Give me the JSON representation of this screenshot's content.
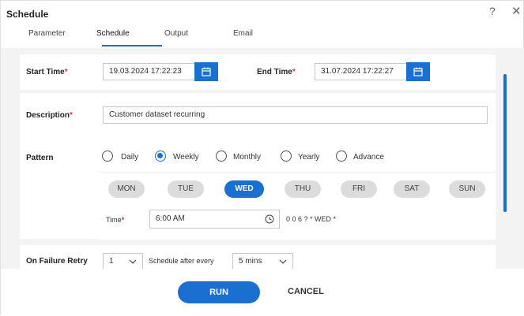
{
  "window": {
    "title": "Schedule",
    "help_glyph": "?",
    "close_glyph": "✕"
  },
  "tabs": [
    "Parameter",
    "Schedule",
    "Output",
    "Email"
  ],
  "start_time": {
    "label": "Start Time",
    "value": "19.03.2024 17:22:23"
  },
  "end_time": {
    "label": "End Time",
    "value": "31.07.2024 17:22:27"
  },
  "description": {
    "label": "Description",
    "value": "Customer dataset recurring"
  },
  "pattern": {
    "label": "Pattern",
    "options": [
      "Daily",
      "Weekly",
      "Monthly",
      "Yearly",
      "Advance"
    ],
    "selected": "Weekly"
  },
  "days": [
    "MON",
    "TUE",
    "WED",
    "THU",
    "FRI",
    "SAT",
    "SUN"
  ],
  "selected_day": "WED",
  "time": {
    "label": "Time",
    "value": "6:00 AM",
    "cron": "0 0 6 ? * WED *"
  },
  "failure": {
    "label": "On Failure Retry",
    "retry_value": "1",
    "schedule_label": "Schedule after every",
    "interval_value": "5 mins"
  },
  "buttons": {
    "run": "RUN",
    "cancel": "CANCEL"
  },
  "required_mark": "*",
  "colors": {
    "accent": "#1a6fd1",
    "required": "#d9304a"
  }
}
